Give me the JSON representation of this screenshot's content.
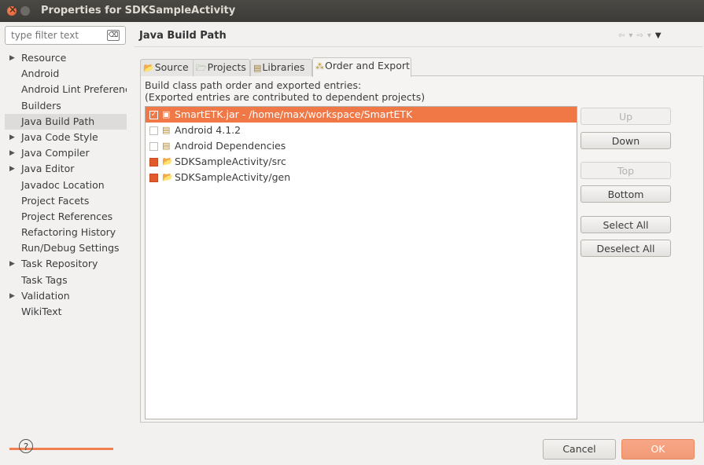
{
  "window": {
    "title": "Properties for SDKSampleActivity"
  },
  "filter": {
    "placeholder": "type filter text"
  },
  "tree": [
    {
      "label": "Resource",
      "expandable": true
    },
    {
      "label": "Android",
      "expandable": false
    },
    {
      "label": "Android Lint Preferences",
      "expandable": false
    },
    {
      "label": "Builders",
      "expandable": false
    },
    {
      "label": "Java Build Path",
      "expandable": false,
      "selected": true
    },
    {
      "label": "Java Code Style",
      "expandable": true
    },
    {
      "label": "Java Compiler",
      "expandable": true
    },
    {
      "label": "Java Editor",
      "expandable": true
    },
    {
      "label": "Javadoc Location",
      "expandable": false
    },
    {
      "label": "Project Facets",
      "expandable": false
    },
    {
      "label": "Project References",
      "expandable": false
    },
    {
      "label": "Refactoring History",
      "expandable": false
    },
    {
      "label": "Run/Debug Settings",
      "expandable": false
    },
    {
      "label": "Task Repository",
      "expandable": true
    },
    {
      "label": "Task Tags",
      "expandable": false
    },
    {
      "label": "Validation",
      "expandable": true
    },
    {
      "label": "WikiText",
      "expandable": false
    }
  ],
  "page": {
    "title": "Java Build Path"
  },
  "tabs": [
    {
      "label": "Source",
      "icon": "source-folder-icon"
    },
    {
      "label": "Projects",
      "icon": "projects-icon"
    },
    {
      "label": "Libraries",
      "icon": "libraries-icon"
    },
    {
      "label": "Order and Export",
      "icon": "order-export-icon",
      "active": true
    }
  ],
  "description": {
    "line1": "Build class path order and exported entries:",
    "line2": "(Exported entries are contributed to dependent projects)"
  },
  "entries": [
    {
      "label": "SmartETK.jar - /home/max/workspace/SmartETK",
      "checked": true,
      "selected": true,
      "icon": "jar-icon"
    },
    {
      "label": "Android 4.1.2",
      "checked": false,
      "icon": "library-icon"
    },
    {
      "label": "Android Dependencies",
      "checked": false,
      "icon": "library-icon"
    },
    {
      "label": "SDKSampleActivity/src",
      "checked": true,
      "icon": "source-folder-icon"
    },
    {
      "label": "SDKSampleActivity/gen",
      "checked": true,
      "icon": "source-folder-icon"
    }
  ],
  "buttons": {
    "up": "Up",
    "down": "Down",
    "top": "Top",
    "bottom": "Bottom",
    "select_all": "Select All",
    "deselect_all": "Deselect All"
  },
  "footer": {
    "cancel": "Cancel",
    "ok": "OK",
    "help": "?"
  },
  "colors": {
    "accent": "#f07746",
    "ok_button": "#f29a77",
    "titlebar": "#3c3b37"
  }
}
